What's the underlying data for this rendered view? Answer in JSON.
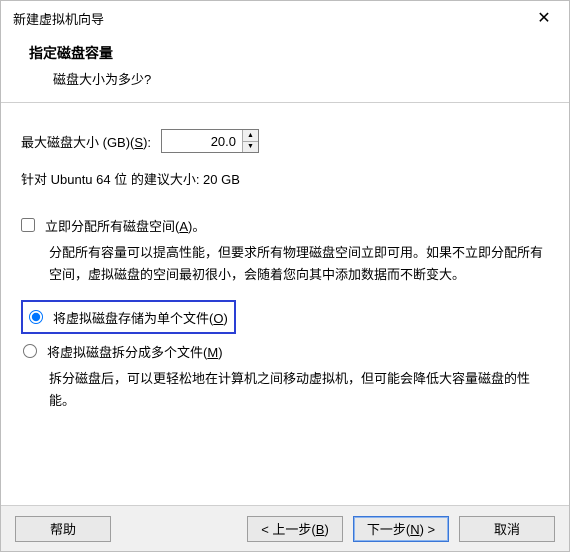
{
  "window": {
    "title": "新建虚拟机向导"
  },
  "header": {
    "title": "指定磁盘容量",
    "subtitle": "磁盘大小为多少?"
  },
  "size": {
    "label_prefix": "最大磁盘大小 (GB)(",
    "label_hotkey": "S",
    "label_suffix": "):",
    "value": "20.0",
    "recommend": "针对 Ubuntu 64 位 的建议大小: 20 GB"
  },
  "allocate": {
    "label_prefix": "立即分配所有磁盘空间(",
    "label_hotkey": "A",
    "label_suffix": ")。",
    "desc": "分配所有容量可以提高性能，但要求所有物理磁盘空间立即可用。如果不立即分配所有空间，虚拟磁盘的空间最初很小，会随着您向其中添加数据而不断变大。"
  },
  "store": {
    "single_prefix": "将虚拟磁盘存储为单个文件(",
    "single_hotkey": "O",
    "single_suffix": ")",
    "split_prefix": "将虚拟磁盘拆分成多个文件(",
    "split_hotkey": "M",
    "split_suffix": ")",
    "split_desc": "拆分磁盘后，可以更轻松地在计算机之间移动虚拟机，但可能会降低大容量磁盘的性能。"
  },
  "footer": {
    "help": "帮助",
    "back_prefix": "< 上一步(",
    "back_hotkey": "B",
    "back_suffix": ")",
    "next_prefix": "下一步(",
    "next_hotkey": "N",
    "next_suffix": ") >",
    "cancel": "取消"
  }
}
